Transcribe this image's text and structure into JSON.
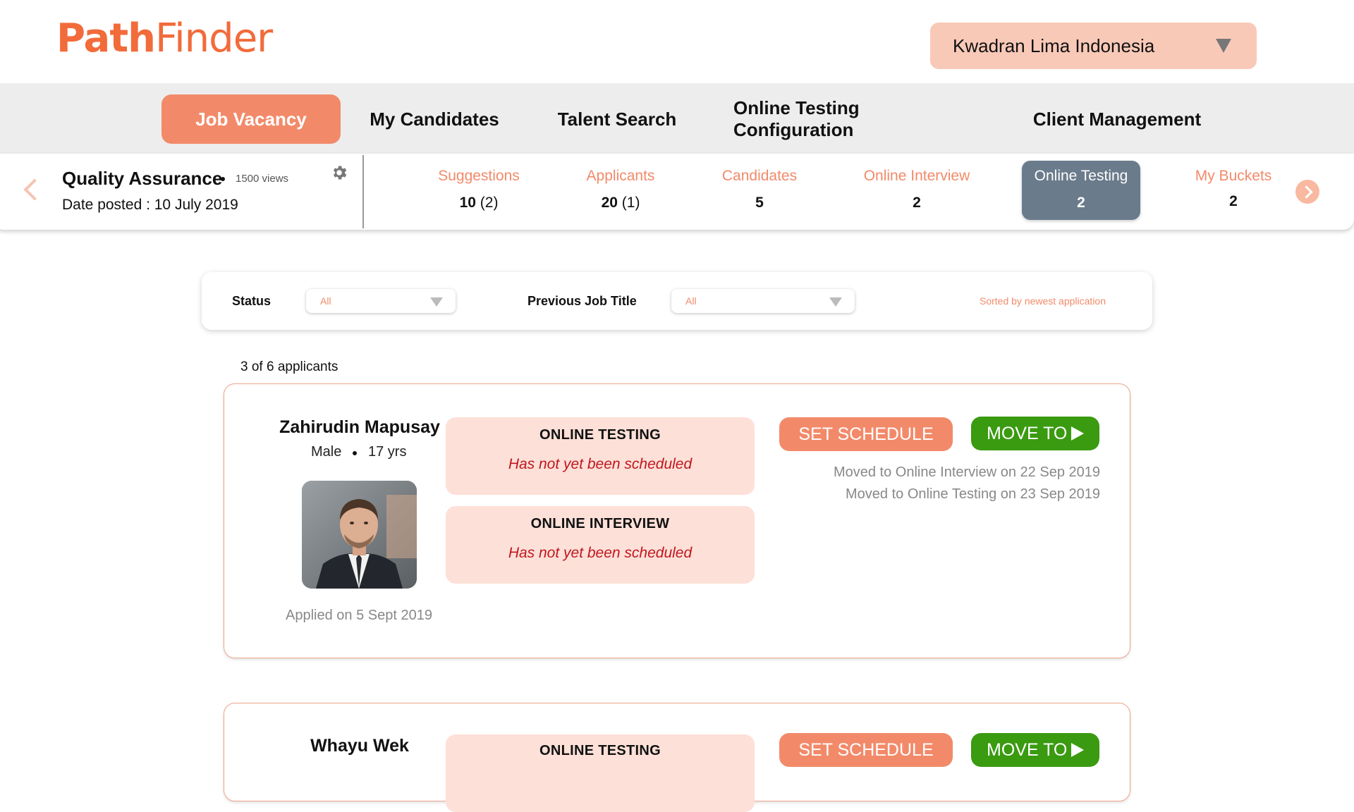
{
  "app": {
    "logo_bold": "Path",
    "logo_light": "Finder"
  },
  "company_select": {
    "value": "Kwadran Lima Indonesia"
  },
  "nav": {
    "items": [
      {
        "label": "Job Vacancy",
        "active": true
      },
      {
        "label": "My Candidates"
      },
      {
        "label": "Talent Search"
      },
      {
        "label": "Online Testing Configuration"
      },
      {
        "label": "Client Management"
      }
    ]
  },
  "job": {
    "title": "Quality Assurance",
    "views": "1500 views",
    "date_posted": "Date posted : 10 July 2019"
  },
  "stages": [
    {
      "label": "Suggestions",
      "count": "10",
      "sub": "(2)"
    },
    {
      "label": "Applicants",
      "count": "20",
      "sub": "(1)"
    },
    {
      "label": "Candidates",
      "count": "5",
      "sub": ""
    },
    {
      "label": "Online Interview",
      "count": "2",
      "sub": ""
    },
    {
      "label": "Online Testing",
      "count": "2",
      "sub": "",
      "active": true
    },
    {
      "label": "My Buckets",
      "count": "2",
      "sub": ""
    }
  ],
  "filters": {
    "status_label": "Status",
    "status_value": "All",
    "prev_job_label": "Previous Job Title",
    "prev_job_value": "All",
    "sorted_text": "Sorted by newest application"
  },
  "applicant_count": "3 of 6 applicants",
  "applicants": [
    {
      "name": "Zahirudin Mapusay",
      "gender": "Male",
      "age": "17 yrs",
      "applied": "Applied on 5 Sept 2019",
      "statuses": [
        {
          "title": "ONLINE TESTING",
          "sub": "Has not yet been scheduled"
        },
        {
          "title": "ONLINE INTERVIEW",
          "sub": "Has not yet been scheduled"
        }
      ],
      "schedule_label": "SET SCHEDULE",
      "move_label": "MOVE TO",
      "history": [
        "Moved to Online Interview on 22 Sep 2019",
        "Moved to Online Testing on 23 Sep 2019"
      ]
    },
    {
      "name": "Whayu Wek",
      "statuses": [
        {
          "title": "ONLINE TESTING"
        }
      ],
      "schedule_label": "SET SCHEDULE",
      "move_label": "MOVE TO"
    }
  ]
}
